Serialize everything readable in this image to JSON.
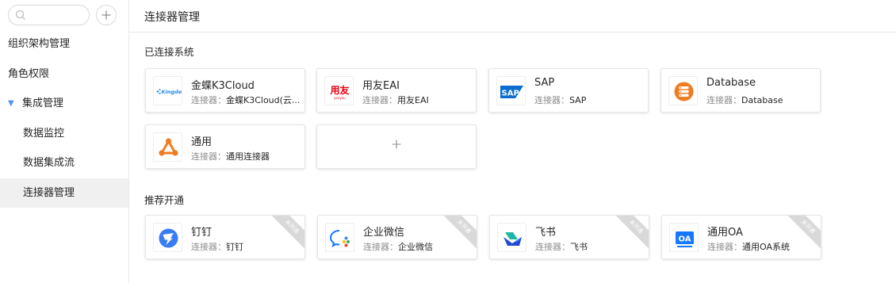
{
  "header": {
    "title": "连接器管理"
  },
  "search": {
    "placeholder": ""
  },
  "sidebar": {
    "items": [
      {
        "label": "组织架构管理"
      },
      {
        "label": "角色权限"
      },
      {
        "label": "集成管理"
      },
      {
        "label": "数据监控"
      },
      {
        "label": "数据集成流"
      },
      {
        "label": "连接器管理"
      }
    ]
  },
  "sections": {
    "connected_title": "已连接系统",
    "recommended_title": "推荐开通"
  },
  "connector_prefix": "连接器：",
  "connected": [
    {
      "name": "金蝶K3Cloud",
      "connector": "金蝶K3Cloud(云...",
      "icon": "kingdee-icon"
    },
    {
      "name": "用友EAI",
      "connector": "用友EAI",
      "icon": "yonyou-icon"
    },
    {
      "name": "SAP",
      "connector": "SAP",
      "icon": "sap-icon"
    },
    {
      "name": "Database",
      "connector": "Database",
      "icon": "database-icon"
    },
    {
      "name": "通用",
      "connector": "通用连接器",
      "icon": "generic-connector-icon"
    }
  ],
  "recommended": [
    {
      "name": "钉钉",
      "connector": "钉钉",
      "icon": "dingtalk-icon",
      "badge": "未开通"
    },
    {
      "name": "企业微信",
      "connector": "企业微信",
      "icon": "wecom-icon",
      "badge": "未开通"
    },
    {
      "name": "飞书",
      "connector": "飞书",
      "icon": "feishu-icon",
      "badge": "未开通"
    },
    {
      "name": "通用OA",
      "connector": "通用OA系统",
      "icon": "oa-icon",
      "badge": "未开通"
    }
  ],
  "logos": {
    "kingdee_text": "Kingdee",
    "yonyou_text": "用友",
    "yonyou_sub": "yonyou",
    "sap_text": "SAP",
    "oa_text": "OA"
  },
  "colors": {
    "kingdee": "#1e88e5",
    "yonyou": "#e60012",
    "sap": "#0a6ed1",
    "database": "#f07c22",
    "generic": "#f07c22",
    "dingtalk": "#3a7bf6",
    "feishu": "#1fb6a8",
    "oa": "#1677ff",
    "badge_bg": "#d9d9d9"
  }
}
